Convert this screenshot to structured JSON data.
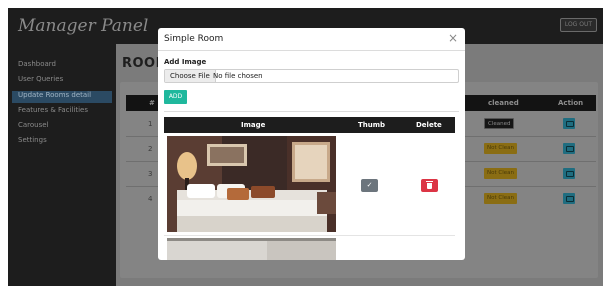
{
  "app": {
    "title": "Manager Panel",
    "logout_label": "LOG OUT"
  },
  "sidebar": {
    "items": [
      {
        "label": "Dashboard",
        "active": false
      },
      {
        "label": "User Queries",
        "active": false
      },
      {
        "label": "Update Rooms detail",
        "active": true
      },
      {
        "label": "Features & Facilities",
        "active": false
      },
      {
        "label": "Carousel",
        "active": false
      },
      {
        "label": "Settings",
        "active": false
      }
    ]
  },
  "main": {
    "page_title": "ROOM",
    "table": {
      "headers": {
        "num": "#",
        "cleaned": "cleaned",
        "action": "Action"
      },
      "rows": [
        {
          "num": "1",
          "status": "Cleaned"
        },
        {
          "num": "2",
          "status": "Not Clean"
        },
        {
          "num": "3",
          "status": "Not Clean"
        },
        {
          "num": "4",
          "status": "Not Clean"
        }
      ]
    }
  },
  "modal": {
    "title": "Simple Room",
    "close_glyph": "×",
    "add_image_label": "Add Image",
    "file_button_label": "Choose File",
    "file_status": "No file chosen",
    "add_button_label": "ADD",
    "image_table": {
      "headers": {
        "image": "Image",
        "thumb": "Thumb",
        "delete": "Delete"
      },
      "rows": [
        {
          "image": "hotel-room-photo",
          "thumb_glyph": "✓",
          "is_thumb": true
        }
      ]
    }
  },
  "colors": {
    "accent_teal": "#1fb89d",
    "delete_red": "#dc3545",
    "thumb_gray": "#6c757d",
    "badge_not_clean": "#b48d16",
    "action_blue": "#1fa2c2"
  },
  "icons": {
    "thumb": "check-icon",
    "delete": "trash-icon",
    "action": "edit-icon",
    "close": "close-icon"
  }
}
